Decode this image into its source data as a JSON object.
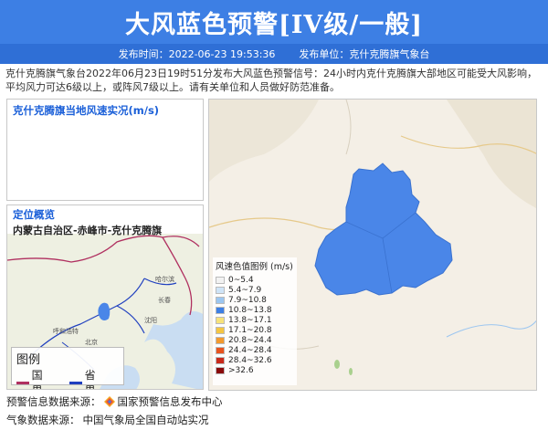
{
  "header": {
    "title": "大风蓝色预警[IV级/一般]",
    "publish_time_label": "发布时间：2022-06-23 19:53:36",
    "publisher_label": "发布单位：克什克腾旗气象台"
  },
  "description": "克什克腾旗气象台2022年06月23日19时51分发布大风蓝色预警信号：24小时内克什克腾旗大部地区可能受大风影响，平均风力可达6级以上，或阵风7级以上。请有关单位和人员做好防范准备。",
  "wind_panel": {
    "title": "克什克腾旗当地风速实况(m/s)"
  },
  "location_panel": {
    "title": "定位概览",
    "region": "内蒙古自治区-赤峰市-克什克腾旗",
    "map_labels": [
      "哈尔滨",
      "长春",
      "沈阳",
      "北京",
      "呼和浩特"
    ],
    "legend_title": "图例",
    "legend_items": [
      {
        "label": "国界",
        "color": "#b03060"
      },
      {
        "label": "省界",
        "color": "#1f3fbf"
      }
    ]
  },
  "main_map": {
    "legend_title": "风速色值图例 (m/s)",
    "scale": [
      {
        "label": "0~5.4",
        "color": "#f2f2f2"
      },
      {
        "label": "5.4~7.9",
        "color": "#cfe4f7"
      },
      {
        "label": "7.9~10.8",
        "color": "#9cc6f0"
      },
      {
        "label": "10.8~13.8",
        "color": "#3d7fe4"
      },
      {
        "label": "13.8~17.1",
        "color": "#f7e27a"
      },
      {
        "label": "17.1~20.8",
        "color": "#f5c542"
      },
      {
        "label": "20.8~24.4",
        "color": "#f39a2e"
      },
      {
        "label": "24.4~28.4",
        "color": "#e8541e"
      },
      {
        "label": "28.4~32.6",
        "color": "#c92a1a"
      },
      {
        "label": ">32.6",
        "color": "#8a0a0a"
      }
    ],
    "region_color": "#4a86e8"
  },
  "footer": {
    "source1_label": "预警信息数据来源：",
    "source1_value": "国家预警信息发布中心",
    "source2_label": "气象数据来源：",
    "source2_value": "中国气象局全国自动站实况"
  }
}
